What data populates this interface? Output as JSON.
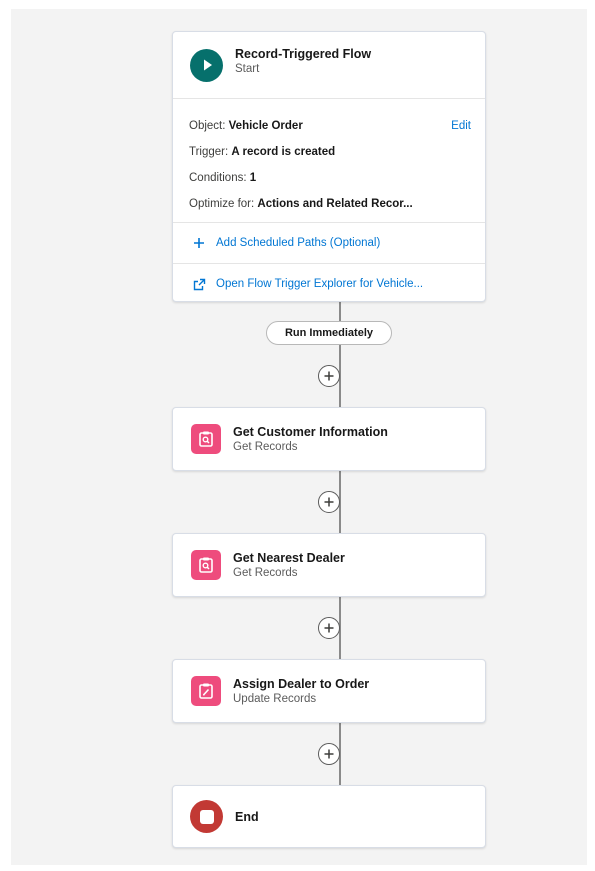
{
  "start": {
    "title": "Record-Triggered Flow",
    "subtitle": "Start",
    "edit_label": "Edit",
    "details": [
      {
        "label": "Object:",
        "value": "Vehicle Order"
      },
      {
        "label": "Trigger:",
        "value": "A record is created"
      },
      {
        "label": "Conditions:",
        "value": "1"
      },
      {
        "label": "Optimize for:",
        "value": "Actions and Related Recor..."
      }
    ],
    "add_scheduled_paths": "Add Scheduled Paths (Optional)",
    "open_trigger_explorer": "Open Flow Trigger Explorer for Vehicle..."
  },
  "path_label": "Run Immediately",
  "elements": [
    {
      "title": "Get Customer Information",
      "subtitle": "Get Records",
      "icon": "get-records-icon"
    },
    {
      "title": "Get Nearest Dealer",
      "subtitle": "Get Records",
      "icon": "get-records-icon"
    },
    {
      "title": "Assign Dealer to Order",
      "subtitle": "Update Records",
      "icon": "update-records-icon"
    }
  ],
  "end": {
    "title": "End"
  },
  "colors": {
    "start_icon": "#06706c",
    "end_icon": "#c23934",
    "element_icon": "#ee4c7d",
    "link": "#0176d3"
  }
}
